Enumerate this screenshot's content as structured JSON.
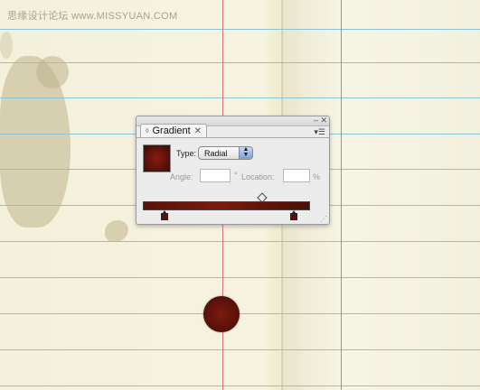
{
  "watermark": "思缘设计论坛 www.MISSYUAN.COM",
  "panel": {
    "tab_label": "Gradient",
    "tab_arrows": "◊",
    "close_glyph": "✕",
    "minimize_glyph": "–",
    "panel_close_glyph": "✕",
    "menu_glyph": "▾☰",
    "type_label": "Type:",
    "type_value": "Radial",
    "angle_label": "Angle:",
    "angle_value": "",
    "angle_unit": "°",
    "location_label": "Location:",
    "location_value": "",
    "location_unit": "%",
    "resize_glyph": "⋰"
  },
  "colors": {
    "stop_color": "#5a120a",
    "ruled_line": "#8cc2d6",
    "margin_line": "#d87a7a"
  },
  "icons": {
    "tab_arrows": "double-arrow-icon",
    "close": "close-icon",
    "menu": "panel-menu-icon",
    "resize": "resize-grip-icon"
  }
}
